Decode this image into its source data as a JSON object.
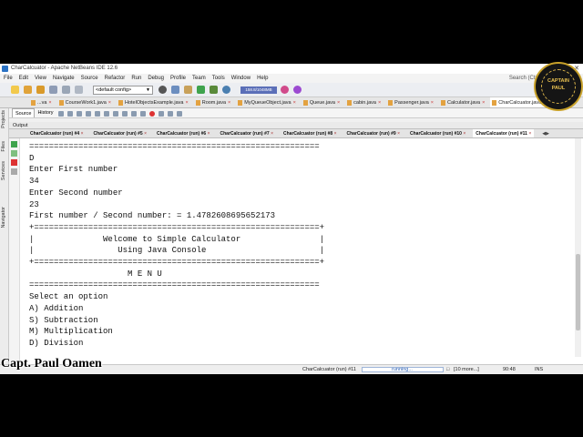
{
  "window": {
    "title": "CharCalcuator - Apache NetBeans IDE 12.6"
  },
  "menu": [
    "File",
    "Edit",
    "View",
    "Navigate",
    "Source",
    "Refactor",
    "Run",
    "Debug",
    "Profile",
    "Team",
    "Tools",
    "Window",
    "Help"
  ],
  "search": {
    "placeholder": "Search (Ctrl+I)"
  },
  "toolbar": {
    "config": "<default config>",
    "memory": "158.8/1048MB"
  },
  "file_tabs": [
    {
      "label": "...va"
    },
    {
      "label": "CourseWork1.java"
    },
    {
      "label": "HotelObjectsExample.java"
    },
    {
      "label": "Room.java"
    },
    {
      "label": "MyQueueObject.java"
    },
    {
      "label": "Queue.java"
    },
    {
      "label": "cabin.java"
    },
    {
      "label": "Passenger.java"
    },
    {
      "label": "Calculator.java"
    },
    {
      "label": "CharCalcuator.java",
      "active": true
    }
  ],
  "editor_tabs": {
    "source": "Source",
    "history": "History"
  },
  "sidebar": {
    "projects": "Projects",
    "files": "Files",
    "services": "Services",
    "navigator": "Navigator"
  },
  "output": {
    "title": "Output",
    "run_tabs": [
      "CharCalcuator (run) #4",
      "CharCalcuator (run) #5",
      "CharCalcuator (run) #6",
      "CharCalcuator (run) #7",
      "CharCalcuator (run) #8",
      "CharCalcuator (run) #9",
      "CharCalcuator (run) #10",
      "CharCalcuator (run) #11"
    ],
    "console_lines": [
      "===========================================================",
      "D",
      "Enter First number",
      "34",
      "Enter Second number",
      "23",
      "First number / Second number: = 1.4782608695652173",
      "+==========================================================+",
      "|              Welcome to Simple Calculator                |",
      "|                 Using Java Console                       |",
      "+==========================================================+",
      "                    M E N U",
      "===========================================================",
      "Select an option",
      "A) Addition",
      "S) Subtraction",
      "M) Multiplication",
      "D) Division",
      "",
      "==========================================================="
    ]
  },
  "status": {
    "task": "CharCalcuator (run) #11",
    "progress": "running...",
    "more": "[10 more...]",
    "position": "90:48",
    "mode": "INS"
  },
  "logo": {
    "top": "CAPTAIN",
    "bottom": "PAUL"
  },
  "watermark": "Capt. Paul Oamen"
}
